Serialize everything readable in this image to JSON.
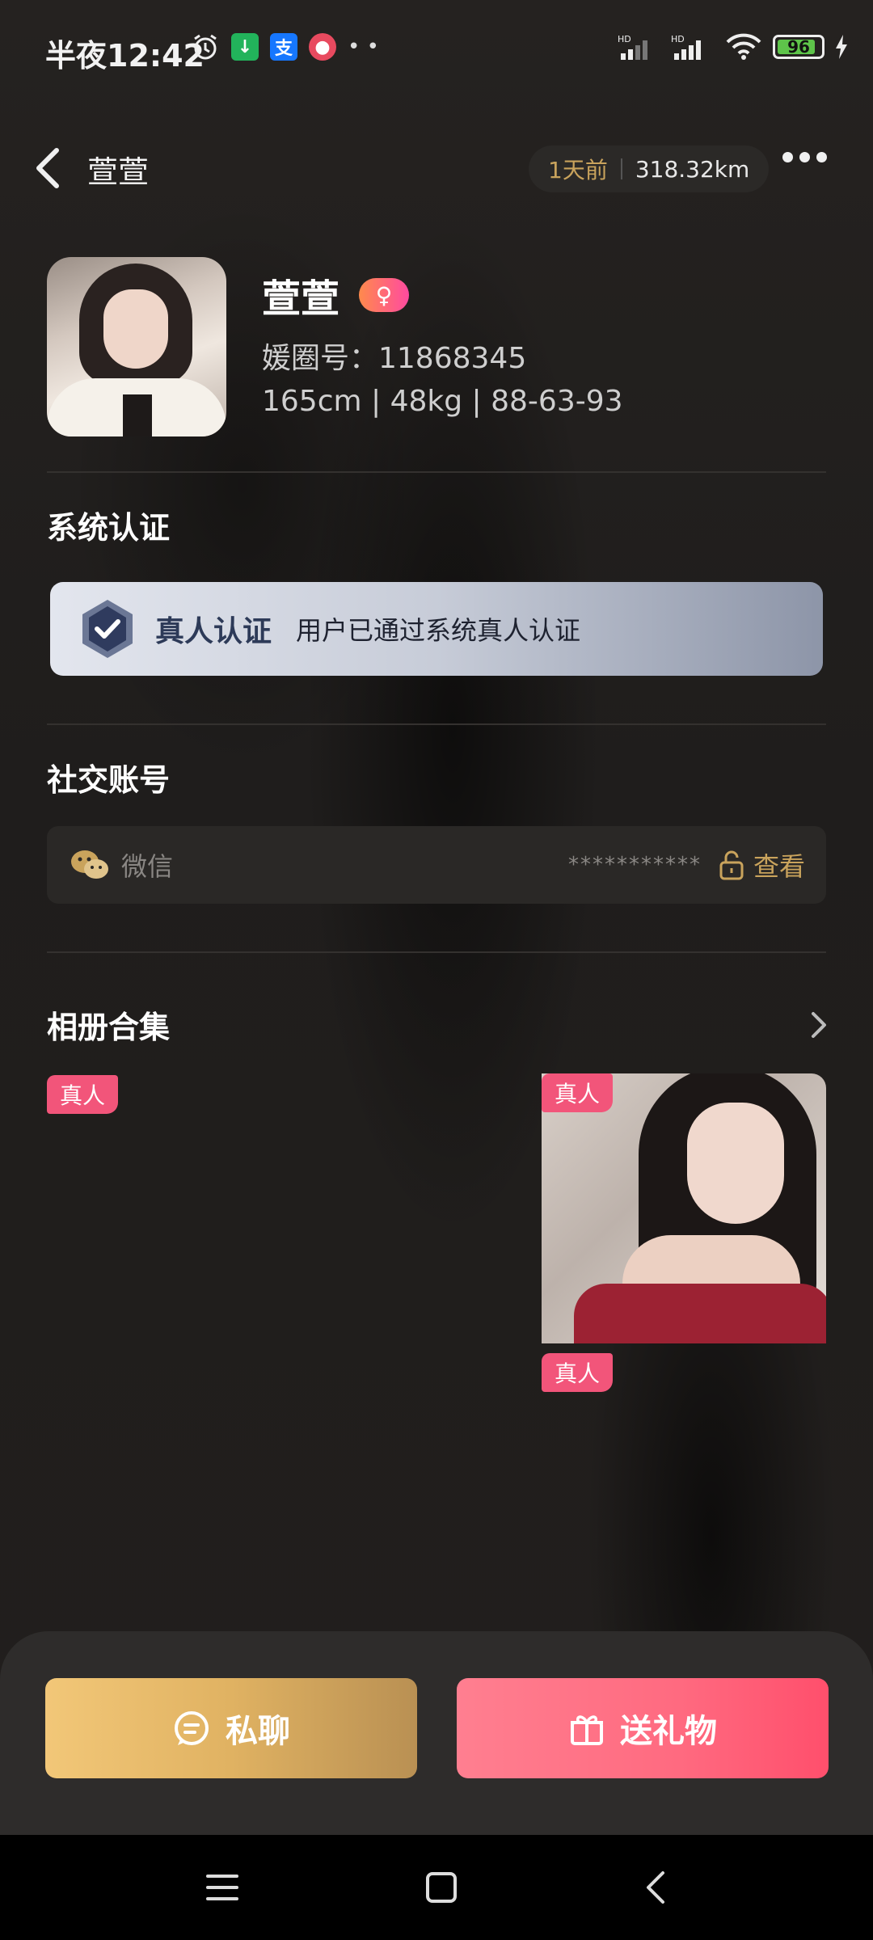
{
  "status_bar": {
    "time": "半夜12:42",
    "app_icon_alipay": "支",
    "battery": "96"
  },
  "header": {
    "title": "萱萱",
    "last_active": "1天前",
    "distance": "318.32km"
  },
  "profile": {
    "name": "萱萱",
    "gender_symbol": "♀",
    "id_line": "媛圈号：11868345",
    "stats": "165cm | 48kg | 88-63-93"
  },
  "verification": {
    "section_title": "系统认证",
    "label": "真人认证",
    "description": "用户已通过系统真人认证"
  },
  "social": {
    "section_title": "社交账号",
    "platform": "微信",
    "masked_value": "***********",
    "view_label": "查看"
  },
  "album": {
    "section_title": "相册合集",
    "tags": [
      "真人",
      "真人",
      "真人"
    ]
  },
  "actions": {
    "chat_label": "私聊",
    "gift_label": "送礼物"
  },
  "colors": {
    "accent_gold": "#c9a35c",
    "chat_button": "#e0b262",
    "gift_button": "#ff6a80",
    "tag_pink": "#f2557a"
  }
}
